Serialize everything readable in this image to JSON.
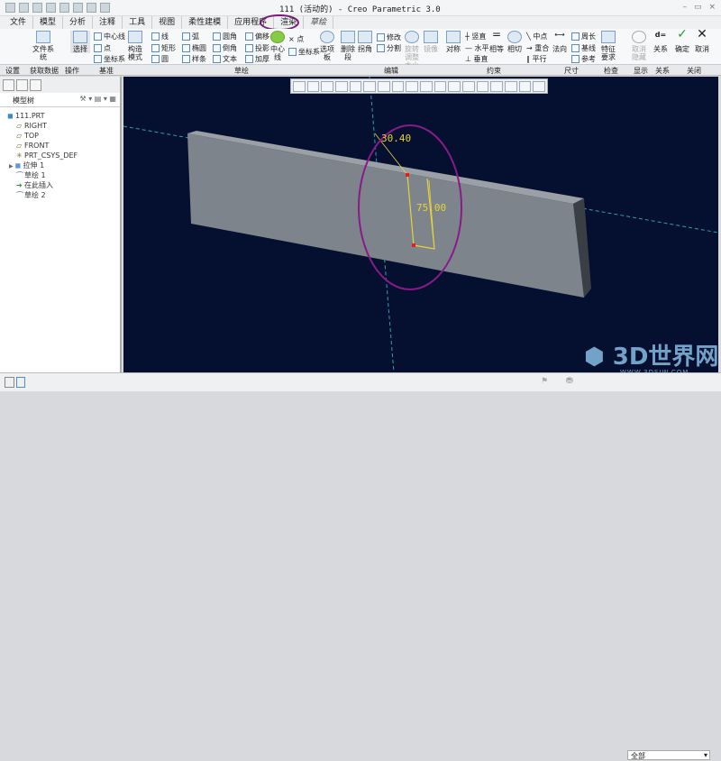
{
  "title": "111 (活动的) - Creo Parametric 3.0",
  "tabs": [
    "文件",
    "模型",
    "分析",
    "注释",
    "工具",
    "视图",
    "柔性建模",
    "应用程序",
    "渲染",
    "草绘"
  ],
  "ribbon": {
    "setup": "设置",
    "get_data": "获取数据",
    "file_system": "文件系统",
    "select": "选择",
    "operations": "操作",
    "centerline": "中心线",
    "point": "点",
    "csys": "坐标系",
    "datum": "基准",
    "construction": "构造模式",
    "line": "线",
    "arc": "弧",
    "fillet": "圆角",
    "offset": "偏移",
    "rectangle": "矩形",
    "ellipse": "椭圆",
    "chamfer": "倒角",
    "project": "投影",
    "circle": "圆",
    "spline": "样条",
    "text": "文本",
    "thicken": "加厚",
    "centerline2": "中心线",
    "point2": "点",
    "csys2": "坐标系",
    "palette": "选项板",
    "sketch_group": "草绘",
    "delete_segment": "删除段",
    "corner": "拐角",
    "modify": "修改",
    "divide": "分割",
    "rotate_resize": "旋转调整大小",
    "mirror": "镜像",
    "edit_group": "编辑",
    "symmetric": "对称",
    "vertical": "竖直",
    "horizontal": "水平",
    "perpendicular": "垂直",
    "equal": "相等",
    "tangent": "相切",
    "midpoint": "中点",
    "coincident": "重合",
    "parallel": "平行",
    "constrain_group": "约束",
    "normal": "法向",
    "perimeter": "周长",
    "baseline": "基线",
    "reference": "参考",
    "dimension_group": "尺寸",
    "feature_req": "特征要求",
    "inspect_group": "检查",
    "hide": "取消隐藏",
    "display_group": "显示",
    "relations": "关系",
    "relations_group": "关系",
    "ok": "确定",
    "cancel": "取消",
    "close_group": "关闭"
  },
  "model_tree": {
    "title": "模型树",
    "items": [
      "111.PRT",
      "RIGHT",
      "TOP",
      "FRONT",
      "PRT_CSYS_DEF",
      "拉伸 1",
      "草绘 1",
      "在此插入",
      "草绘 2"
    ]
  },
  "graphics": {
    "dim1": "30.40",
    "dim2": "75.00",
    "bg": "#051030",
    "model": "#7d848c",
    "highlight": "#7a1a7a"
  },
  "status": {
    "filter": "全部"
  },
  "watermark": {
    "name": "3D世界网",
    "url": "WWW.3DSJW.COM"
  }
}
